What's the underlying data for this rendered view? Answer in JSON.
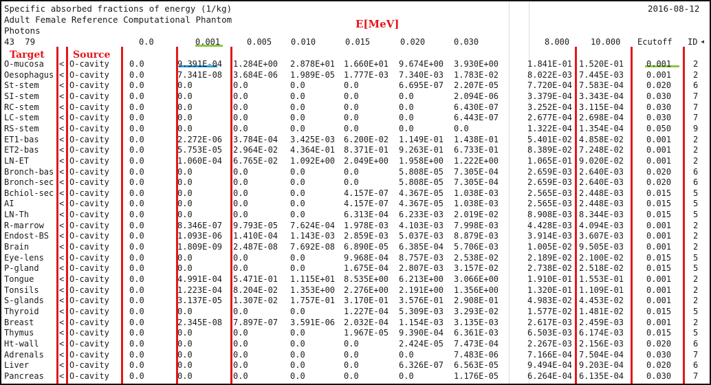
{
  "header": {
    "title": "Specific absorbed fractions of energy (1/kg)",
    "date": "2016-08-12",
    "phantom": "Adult Female Reference Computational Phantom",
    "particle": "Photons",
    "counts": "43  79"
  },
  "annotations": {
    "energy_label": "E[MeV]",
    "target_label": "Target",
    "source_label": "Source"
  },
  "columns": [
    "0.0",
    "0.001",
    "0.005",
    "0.010",
    "0.015",
    "0.020",
    "0.030",
    "8.000",
    "10.000",
    "Ecutoff",
    "ID"
  ],
  "colors": {
    "annotation_red": "#e4161b",
    "underline_green": "#8cc63f",
    "underline_blue": "#1f9bd8"
  },
  "rows": [
    {
      "target": "O-mucosa",
      "source": "O-cavity",
      "v": [
        "0.0",
        "9.391E-04",
        "1.284E+00",
        "2.878E+01",
        "1.660E+01",
        "9.674E+00",
        "3.930E+00",
        "1.841E-01",
        "1.520E-01",
        "0.001"
      ],
      "id": "2"
    },
    {
      "target": "Oesophagus",
      "source": "O-cavity",
      "v": [
        "0.0",
        "7.341E-08",
        "3.684E-06",
        "1.989E-05",
        "1.777E-03",
        "7.340E-03",
        "1.783E-02",
        "8.022E-03",
        "7.445E-03",
        "0.001"
      ],
      "id": "2"
    },
    {
      "target": "St-stem",
      "source": "O-cavity",
      "v": [
        "0.0",
        "0.0",
        "0.0",
        "0.0",
        "0.0",
        "6.695E-07",
        "2.207E-05",
        "7.720E-04",
        "7.583E-04",
        "0.020"
      ],
      "id": "6"
    },
    {
      "target": "SI-stem",
      "source": "O-cavity",
      "v": [
        "0.0",
        "0.0",
        "0.0",
        "0.0",
        "0.0",
        "0.0",
        "2.094E-06",
        "3.379E-04",
        "3.343E-04",
        "0.030"
      ],
      "id": "7"
    },
    {
      "target": "RC-stem",
      "source": "O-cavity",
      "v": [
        "0.0",
        "0.0",
        "0.0",
        "0.0",
        "0.0",
        "0.0",
        "6.430E-07",
        "3.252E-04",
        "3.115E-04",
        "0.030"
      ],
      "id": "7"
    },
    {
      "target": "LC-stem",
      "source": "O-cavity",
      "v": [
        "0.0",
        "0.0",
        "0.0",
        "0.0",
        "0.0",
        "0.0",
        "6.443E-07",
        "2.677E-04",
        "2.698E-04",
        "0.030"
      ],
      "id": "7"
    },
    {
      "target": "RS-stem",
      "source": "O-cavity",
      "v": [
        "0.0",
        "0.0",
        "0.0",
        "0.0",
        "0.0",
        "0.0",
        "0.0",
        "1.322E-04",
        "1.354E-04",
        "0.050"
      ],
      "id": "9"
    },
    {
      "target": "ET1-bas",
      "source": "O-cavity",
      "v": [
        "0.0",
        "2.272E-06",
        "3.784E-04",
        "3.425E-03",
        "6.200E-02",
        "1.149E-01",
        "1.438E-01",
        "5.401E-02",
        "4.858E-02",
        "0.001"
      ],
      "id": "2"
    },
    {
      "target": "ET2-bas",
      "source": "O-cavity",
      "v": [
        "0.0",
        "5.753E-05",
        "2.964E-02",
        "4.364E-01",
        "8.371E-01",
        "9.263E-01",
        "6.733E-01",
        "8.389E-02",
        "7.248E-02",
        "0.001"
      ],
      "id": "2"
    },
    {
      "target": "LN-ET",
      "source": "O-cavity",
      "v": [
        "0.0",
        "1.060E-04",
        "6.765E-02",
        "1.092E+00",
        "2.049E+00",
        "1.958E+00",
        "1.222E+00",
        "1.065E-01",
        "9.020E-02",
        "0.001"
      ],
      "id": "2"
    },
    {
      "target": "Bronch-bas",
      "source": "O-cavity",
      "v": [
        "0.0",
        "0.0",
        "0.0",
        "0.0",
        "0.0",
        "5.808E-05",
        "7.305E-04",
        "2.659E-03",
        "2.640E-03",
        "0.020"
      ],
      "id": "6"
    },
    {
      "target": "Bronch-sec",
      "source": "O-cavity",
      "v": [
        "0.0",
        "0.0",
        "0.0",
        "0.0",
        "0.0",
        "5.808E-05",
        "7.305E-04",
        "2.659E-03",
        "2.640E-03",
        "0.020"
      ],
      "id": "6"
    },
    {
      "target": "Bchiol-sec",
      "source": "O-cavity",
      "v": [
        "0.0",
        "0.0",
        "0.0",
        "0.0",
        "4.157E-07",
        "4.367E-05",
        "1.038E-03",
        "2.565E-03",
        "2.448E-03",
        "0.015"
      ],
      "id": "5"
    },
    {
      "target": "AI",
      "source": "O-cavity",
      "v": [
        "0.0",
        "0.0",
        "0.0",
        "0.0",
        "4.157E-07",
        "4.367E-05",
        "1.038E-03",
        "2.565E-03",
        "2.448E-03",
        "0.015"
      ],
      "id": "5"
    },
    {
      "target": "LN-Th",
      "source": "O-cavity",
      "v": [
        "0.0",
        "0.0",
        "0.0",
        "0.0",
        "6.313E-04",
        "6.233E-03",
        "2.019E-02",
        "8.908E-03",
        "8.344E-03",
        "0.015"
      ],
      "id": "5"
    },
    {
      "target": "R-marrow",
      "source": "O-cavity",
      "v": [
        "0.0",
        "8.346E-07",
        "9.793E-05",
        "7.624E-04",
        "1.978E-03",
        "4.103E-03",
        "7.998E-03",
        "4.428E-03",
        "4.094E-03",
        "0.001"
      ],
      "id": "2"
    },
    {
      "target": "Endost-BS",
      "source": "O-cavity",
      "v": [
        "0.0",
        "1.093E-06",
        "1.410E-04",
        "1.143E-03",
        "2.859E-03",
        "5.037E-03",
        "8.879E-03",
        "3.914E-03",
        "3.607E-03",
        "0.001"
      ],
      "id": "2"
    },
    {
      "target": "Brain",
      "source": "O-cavity",
      "v": [
        "0.0",
        "1.809E-09",
        "2.487E-08",
        "7.692E-08",
        "6.890E-05",
        "6.385E-04",
        "5.706E-03",
        "1.005E-02",
        "9.505E-03",
        "0.001"
      ],
      "id": "2"
    },
    {
      "target": "Eye-lens",
      "source": "O-cavity",
      "v": [
        "0.0",
        "0.0",
        "0.0",
        "0.0",
        "9.968E-04",
        "8.757E-03",
        "2.538E-02",
        "2.189E-02",
        "2.100E-02",
        "0.015"
      ],
      "id": "5"
    },
    {
      "target": "P-gland",
      "source": "O-cavity",
      "v": [
        "0.0",
        "0.0",
        "0.0",
        "0.0",
        "1.675E-04",
        "2.807E-03",
        "3.157E-02",
        "2.738E-02",
        "2.518E-02",
        "0.015"
      ],
      "id": "5"
    },
    {
      "target": "Tongue",
      "source": "O-cavity",
      "v": [
        "0.0",
        "4.991E-04",
        "5.471E-01",
        "1.115E+01",
        "8.535E+00",
        "6.213E+00",
        "3.066E+00",
        "1.910E-01",
        "1.553E-01",
        "0.001"
      ],
      "id": "2"
    },
    {
      "target": "Tonsils",
      "source": "O-cavity",
      "v": [
        "0.0",
        "1.223E-04",
        "8.204E-02",
        "1.353E+00",
        "2.276E+00",
        "2.191E+00",
        "1.356E+00",
        "1.320E-01",
        "1.109E-01",
        "0.001"
      ],
      "id": "2"
    },
    {
      "target": "S-glands",
      "source": "O-cavity",
      "v": [
        "0.0",
        "3.137E-05",
        "1.307E-02",
        "1.757E-01",
        "3.170E-01",
        "3.576E-01",
        "2.908E-01",
        "4.983E-02",
        "4.453E-02",
        "0.001"
      ],
      "id": "2"
    },
    {
      "target": "Thyroid",
      "source": "O-cavity",
      "v": [
        "0.0",
        "0.0",
        "0.0",
        "0.0",
        "1.227E-04",
        "5.309E-03",
        "3.293E-02",
        "1.577E-02",
        "1.481E-02",
        "0.015"
      ],
      "id": "5"
    },
    {
      "target": "Breast",
      "source": "O-cavity",
      "v": [
        "0.0",
        "2.345E-08",
        "7.897E-07",
        "3.591E-06",
        "2.032E-04",
        "1.154E-03",
        "3.135E-03",
        "2.617E-03",
        "2.459E-03",
        "0.001"
      ],
      "id": "2"
    },
    {
      "target": "Thymus",
      "source": "O-cavity",
      "v": [
        "0.0",
        "0.0",
        "0.0",
        "0.0",
        "1.967E-05",
        "9.390E-04",
        "6.361E-03",
        "6.503E-03",
        "6.174E-03",
        "0.015"
      ],
      "id": "5"
    },
    {
      "target": "Ht-wall",
      "source": "O-cavity",
      "v": [
        "0.0",
        "0.0",
        "0.0",
        "0.0",
        "0.0",
        "2.424E-05",
        "7.473E-04",
        "2.267E-03",
        "2.156E-03",
        "0.020"
      ],
      "id": "6"
    },
    {
      "target": "Adrenals",
      "source": "O-cavity",
      "v": [
        "0.0",
        "0.0",
        "0.0",
        "0.0",
        "0.0",
        "0.0",
        "7.483E-06",
        "7.166E-04",
        "7.504E-04",
        "0.030"
      ],
      "id": "7"
    },
    {
      "target": "Liver",
      "source": "O-cavity",
      "v": [
        "0.0",
        "0.0",
        "0.0",
        "0.0",
        "0.0",
        "6.326E-07",
        "6.563E-05",
        "9.494E-04",
        "9.203E-04",
        "0.020"
      ],
      "id": "6"
    },
    {
      "target": "Pancreas",
      "source": "O-cavity",
      "v": [
        "0.0",
        "0.0",
        "0.0",
        "0.0",
        "0.0",
        "0.0",
        "1.176E-05",
        "6.264E-04",
        "6.135E-04",
        "0.030"
      ],
      "id": "7"
    }
  ]
}
